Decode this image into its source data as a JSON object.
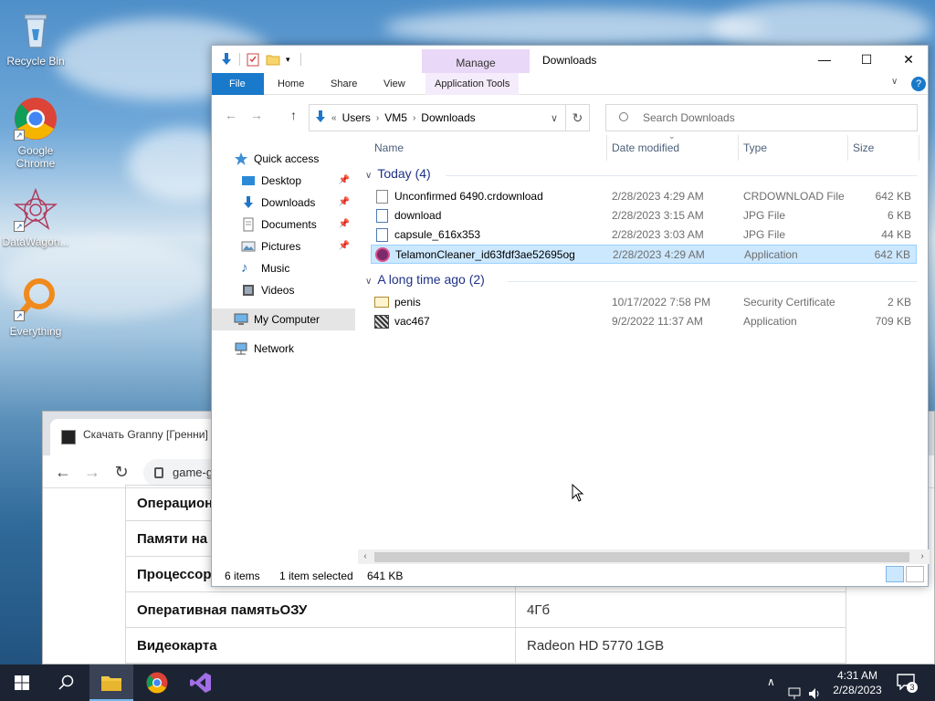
{
  "desktop": {
    "icons": [
      {
        "label": "Recycle Bin"
      },
      {
        "label": "Google Chrome"
      },
      {
        "label": "DataWagon..."
      },
      {
        "label": "Everything"
      }
    ]
  },
  "chrome": {
    "tab_title": "Скачать Granny [Гренни] и",
    "omnibox": "game-g",
    "table": [
      {
        "key": "Операцион",
        "value": ""
      },
      {
        "key": "Памяти на",
        "value": ""
      },
      {
        "key": "Процессор",
        "value": ""
      },
      {
        "key": "Оперативная памятьОЗУ",
        "value": "4Гб"
      },
      {
        "key": "Видеокарта",
        "value": "Radeon HD 5770 1GB"
      }
    ]
  },
  "explorer": {
    "title": "Downloads",
    "manage_tab": "Manage",
    "ribbon_tabs": {
      "file": "File",
      "home": "Home",
      "share": "Share",
      "view": "View",
      "app_tools": "Application Tools"
    },
    "breadcrumb": [
      "Users",
      "VM5",
      "Downloads"
    ],
    "breadcrumb_prefix": "«",
    "search_placeholder": "Search Downloads",
    "nav": {
      "quick_access": "Quick access",
      "desktop": "Desktop",
      "downloads": "Downloads",
      "documents": "Documents",
      "pictures": "Pictures",
      "music": "Music",
      "videos": "Videos",
      "my_computer": "My Computer",
      "network": "Network"
    },
    "columns": {
      "name": "Name",
      "date": "Date modified",
      "type": "Type",
      "size": "Size"
    },
    "groups": [
      {
        "label": "Today (4)",
        "files": [
          {
            "name": "Unconfirmed 6490.crdownload",
            "date": "2/28/2023 4:29 AM",
            "type": "CRDOWNLOAD File",
            "size": "642 KB"
          },
          {
            "name": "download",
            "date": "2/28/2023 3:15 AM",
            "type": "JPG File",
            "size": "6 KB"
          },
          {
            "name": "capsule_616x353",
            "date": "2/28/2023 3:03 AM",
            "type": "JPG File",
            "size": "44 KB"
          },
          {
            "name": "TelamonCleaner_id63fdf3ae52695og",
            "date": "2/28/2023 4:29 AM",
            "type": "Application",
            "size": "642 KB"
          }
        ]
      },
      {
        "label": "A long time ago (2)",
        "files": [
          {
            "name": "penis",
            "date": "10/17/2022 7:58 PM",
            "type": "Security Certificate",
            "size": "2 KB"
          },
          {
            "name": "vac467",
            "date": "9/2/2022 11:37 AM",
            "type": "Application",
            "size": "709 KB"
          }
        ]
      }
    ],
    "status": {
      "items": "6 items",
      "selected": "1 item selected",
      "size": "641 KB"
    }
  },
  "taskbar": {
    "time": "4:31 AM",
    "date": "2/28/2023",
    "notifications": "3"
  }
}
